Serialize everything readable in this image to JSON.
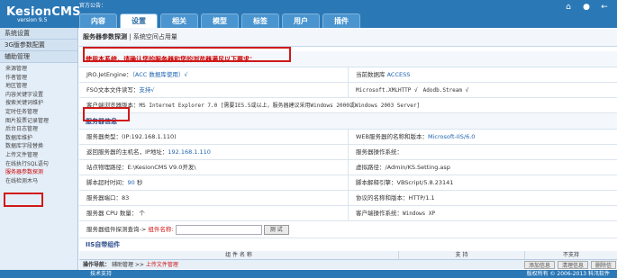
{
  "app": {
    "logo": "KesionCMS",
    "version": "version 9.5",
    "notice_label": "官方公告："
  },
  "tabs": [
    {
      "label": "内容",
      "active": false
    },
    {
      "label": "设置",
      "active": true
    },
    {
      "label": "相关",
      "active": false
    },
    {
      "label": "模型",
      "active": false
    },
    {
      "label": "标签",
      "active": false
    },
    {
      "label": "用户",
      "active": false
    },
    {
      "label": "插件",
      "active": false
    }
  ],
  "sidebar": {
    "sections": [
      {
        "label": "系统设置"
      },
      {
        "label": "3G版参数配置"
      },
      {
        "label": "辅助管理"
      }
    ],
    "items": [
      {
        "label": "来源管理"
      },
      {
        "label": "作者管理"
      },
      {
        "label": "地区管理"
      },
      {
        "label": "内容关键字设置"
      },
      {
        "label": "搜索关键词维护"
      },
      {
        "label": "定时任务管理"
      },
      {
        "label": "图片投票记录管理"
      },
      {
        "label": "后台日志管理"
      },
      {
        "label": "数据库维护"
      },
      {
        "label": "数据库字段替换"
      },
      {
        "label": "上传文件管理"
      },
      {
        "label": "在线执行SQL语句"
      },
      {
        "label": "服务器参数探测"
      },
      {
        "label": "在线检测木马"
      }
    ]
  },
  "breadcrumb": {
    "current": "服务器参数探测",
    "separator": "|",
    "other": "系统空间占用量"
  },
  "requirements": {
    "title": "使用本系统，请确认您的服务器和您的浏览器满足以下要求：",
    "jro_label": "JRO.JetEngine：",
    "jro_value": "（ACC 数据库使用）√",
    "db_label": "当前数据库",
    "db_value": "ACCESS",
    "fso_label": "FSO文本文件读写：",
    "fso_value": "支持√",
    "xmlhttp": "Microsoft.XMLHTTP √",
    "stream": "Adodb.Stream √",
    "browser_label": "客户端浏览器版本：",
    "browser_value": "MS Internet Explorer 7.0 [需要IE5.5或以上，服务器建议采用Windows 2000或Windows 2003 Server]"
  },
  "server_info": {
    "title": "服务器信息",
    "type_label": "服务器类型：(IP:192.168.1.110)",
    "web_label": "WEB服务器的名称和版本：",
    "web_value": "Microsoft-IIS/6.0",
    "host_label": "返回服务器的主机名，IP地址：",
    "host_value": "192.168.1.110",
    "os_label": "服务器操作系统：",
    "path_label": "站点物理路径：E:\\KesionCMS V9.0开发\\",
    "vpath_label": "虚拟路径：/Admin/KS.Setting.asp",
    "timeout_label": "脚本超时时间：",
    "timeout_value": "90",
    "timeout_unit": "秒",
    "engine_label": "脚本解释引擎：VBScript/5.8.23141",
    "port_label": "服务器端口：83",
    "proto_label": "协议的名称和版本：HTTP/1.1",
    "cpu_label": "服务器 CPU 数量： 个",
    "client_os_label": "客户端操作系统：",
    "client_os_value": "Windows XP"
  },
  "probe": {
    "label": "服务器组件探测查询->",
    "name_label": "组件名称:",
    "input_value": "",
    "button": "测 试"
  },
  "iis": {
    "title": "IIS自带组件",
    "col1": "组 件 名 称",
    "col2": "支 持",
    "col3": "不支持"
  },
  "bottom": {
    "nav_label": "操作导航：",
    "path1": "辅助管理",
    "sep": ">>",
    "path2": "上传文件管理",
    "btn1": "添加信息",
    "btn2": "清理信息",
    "btn3": "删除信"
  },
  "footer": {
    "left": "技术支持",
    "right": "版权所有 © 2006-2013 科汛软件"
  }
}
